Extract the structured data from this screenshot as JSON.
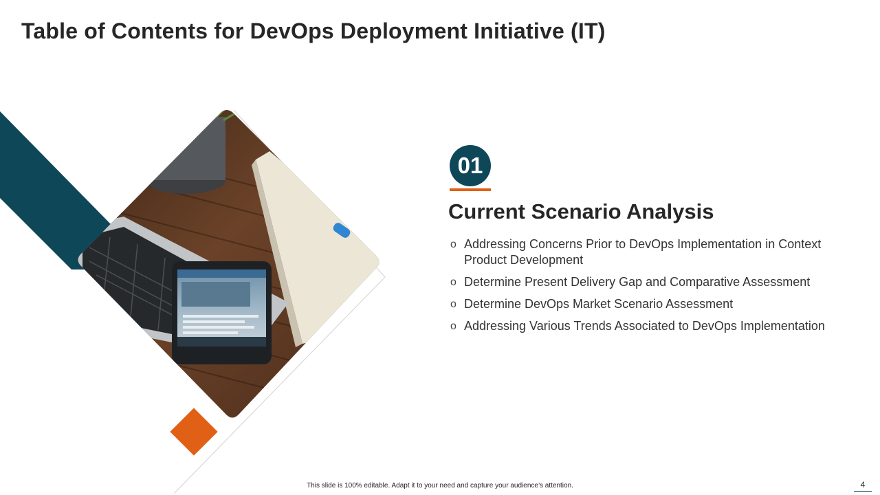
{
  "slide": {
    "title": "Table of Contents for DevOps Deployment Initiative (IT)",
    "page_number": "4",
    "footer_note": "This slide is 100% editable.  Adapt it to your need and capture your audience’s attention."
  },
  "section": {
    "number": "01",
    "heading": "Current Scenario Analysis",
    "bullet_glyph": "o",
    "items": [
      "Addressing Concerns Prior to DevOps Implementation in Context Product Development",
      "Determine Present Delivery Gap and Comparative Assessment",
      "Determine DevOps Market Scenario Assessment",
      "Addressing Various Trends Associated to DevOps Implementation"
    ]
  },
  "colors": {
    "accent_teal": "#0e4758",
    "accent_orange": "#e06016",
    "text_dark": "#262626"
  }
}
